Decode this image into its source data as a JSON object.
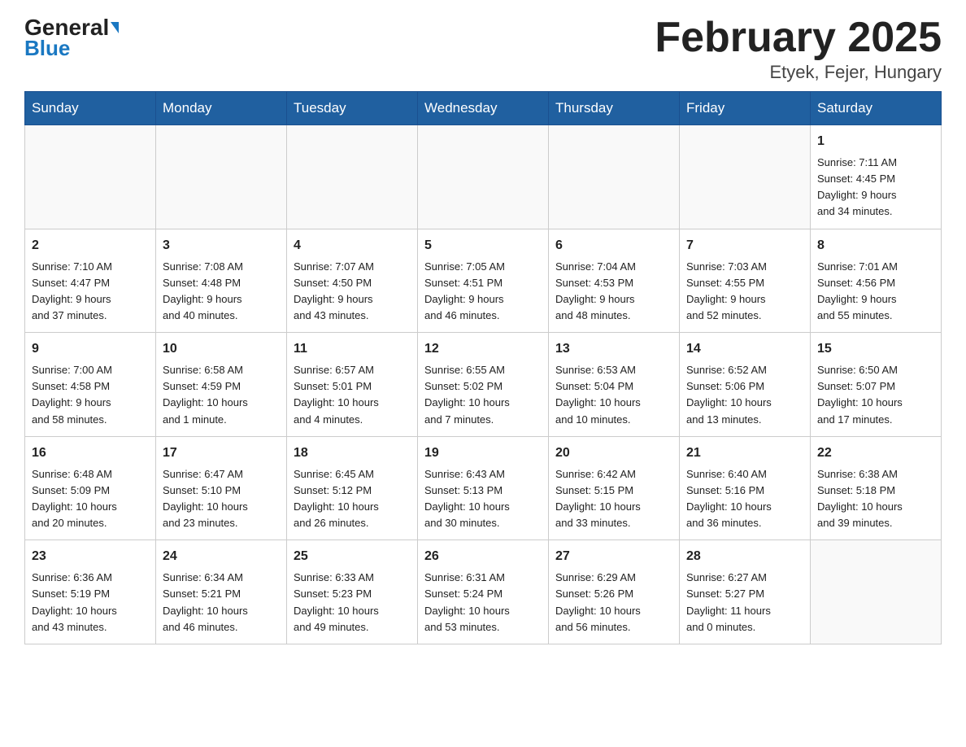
{
  "header": {
    "logo_general": "General",
    "logo_blue": "Blue",
    "month_title": "February 2025",
    "location": "Etyek, Fejer, Hungary"
  },
  "weekdays": [
    "Sunday",
    "Monday",
    "Tuesday",
    "Wednesday",
    "Thursday",
    "Friday",
    "Saturday"
  ],
  "weeks": [
    [
      {
        "day": "",
        "info": ""
      },
      {
        "day": "",
        "info": ""
      },
      {
        "day": "",
        "info": ""
      },
      {
        "day": "",
        "info": ""
      },
      {
        "day": "",
        "info": ""
      },
      {
        "day": "",
        "info": ""
      },
      {
        "day": "1",
        "info": "Sunrise: 7:11 AM\nSunset: 4:45 PM\nDaylight: 9 hours\nand 34 minutes."
      }
    ],
    [
      {
        "day": "2",
        "info": "Sunrise: 7:10 AM\nSunset: 4:47 PM\nDaylight: 9 hours\nand 37 minutes."
      },
      {
        "day": "3",
        "info": "Sunrise: 7:08 AM\nSunset: 4:48 PM\nDaylight: 9 hours\nand 40 minutes."
      },
      {
        "day": "4",
        "info": "Sunrise: 7:07 AM\nSunset: 4:50 PM\nDaylight: 9 hours\nand 43 minutes."
      },
      {
        "day": "5",
        "info": "Sunrise: 7:05 AM\nSunset: 4:51 PM\nDaylight: 9 hours\nand 46 minutes."
      },
      {
        "day": "6",
        "info": "Sunrise: 7:04 AM\nSunset: 4:53 PM\nDaylight: 9 hours\nand 48 minutes."
      },
      {
        "day": "7",
        "info": "Sunrise: 7:03 AM\nSunset: 4:55 PM\nDaylight: 9 hours\nand 52 minutes."
      },
      {
        "day": "8",
        "info": "Sunrise: 7:01 AM\nSunset: 4:56 PM\nDaylight: 9 hours\nand 55 minutes."
      }
    ],
    [
      {
        "day": "9",
        "info": "Sunrise: 7:00 AM\nSunset: 4:58 PM\nDaylight: 9 hours\nand 58 minutes."
      },
      {
        "day": "10",
        "info": "Sunrise: 6:58 AM\nSunset: 4:59 PM\nDaylight: 10 hours\nand 1 minute."
      },
      {
        "day": "11",
        "info": "Sunrise: 6:57 AM\nSunset: 5:01 PM\nDaylight: 10 hours\nand 4 minutes."
      },
      {
        "day": "12",
        "info": "Sunrise: 6:55 AM\nSunset: 5:02 PM\nDaylight: 10 hours\nand 7 minutes."
      },
      {
        "day": "13",
        "info": "Sunrise: 6:53 AM\nSunset: 5:04 PM\nDaylight: 10 hours\nand 10 minutes."
      },
      {
        "day": "14",
        "info": "Sunrise: 6:52 AM\nSunset: 5:06 PM\nDaylight: 10 hours\nand 13 minutes."
      },
      {
        "day": "15",
        "info": "Sunrise: 6:50 AM\nSunset: 5:07 PM\nDaylight: 10 hours\nand 17 minutes."
      }
    ],
    [
      {
        "day": "16",
        "info": "Sunrise: 6:48 AM\nSunset: 5:09 PM\nDaylight: 10 hours\nand 20 minutes."
      },
      {
        "day": "17",
        "info": "Sunrise: 6:47 AM\nSunset: 5:10 PM\nDaylight: 10 hours\nand 23 minutes."
      },
      {
        "day": "18",
        "info": "Sunrise: 6:45 AM\nSunset: 5:12 PM\nDaylight: 10 hours\nand 26 minutes."
      },
      {
        "day": "19",
        "info": "Sunrise: 6:43 AM\nSunset: 5:13 PM\nDaylight: 10 hours\nand 30 minutes."
      },
      {
        "day": "20",
        "info": "Sunrise: 6:42 AM\nSunset: 5:15 PM\nDaylight: 10 hours\nand 33 minutes."
      },
      {
        "day": "21",
        "info": "Sunrise: 6:40 AM\nSunset: 5:16 PM\nDaylight: 10 hours\nand 36 minutes."
      },
      {
        "day": "22",
        "info": "Sunrise: 6:38 AM\nSunset: 5:18 PM\nDaylight: 10 hours\nand 39 minutes."
      }
    ],
    [
      {
        "day": "23",
        "info": "Sunrise: 6:36 AM\nSunset: 5:19 PM\nDaylight: 10 hours\nand 43 minutes."
      },
      {
        "day": "24",
        "info": "Sunrise: 6:34 AM\nSunset: 5:21 PM\nDaylight: 10 hours\nand 46 minutes."
      },
      {
        "day": "25",
        "info": "Sunrise: 6:33 AM\nSunset: 5:23 PM\nDaylight: 10 hours\nand 49 minutes."
      },
      {
        "day": "26",
        "info": "Sunrise: 6:31 AM\nSunset: 5:24 PM\nDaylight: 10 hours\nand 53 minutes."
      },
      {
        "day": "27",
        "info": "Sunrise: 6:29 AM\nSunset: 5:26 PM\nDaylight: 10 hours\nand 56 minutes."
      },
      {
        "day": "28",
        "info": "Sunrise: 6:27 AM\nSunset: 5:27 PM\nDaylight: 11 hours\nand 0 minutes."
      },
      {
        "day": "",
        "info": ""
      }
    ]
  ]
}
